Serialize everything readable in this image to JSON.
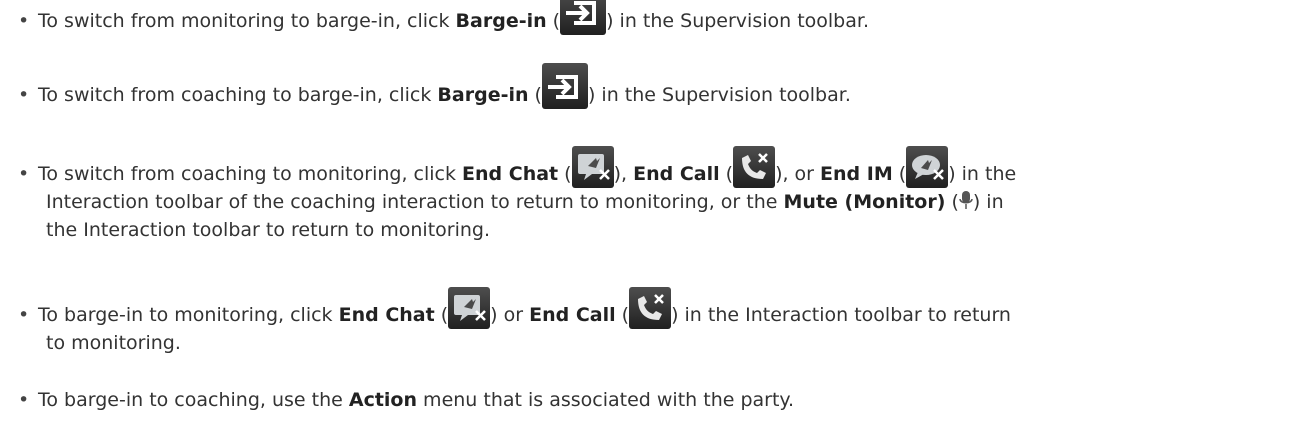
{
  "bullets": [
    {
      "before": "To switch from monitoring to barge-in, click ",
      "bold1": "Barge-in",
      "open1": " (",
      "after1": ") in the Supervision toolbar."
    },
    {
      "before": "To switch from coaching to barge-in, click ",
      "bold1": "Barge-in",
      "open1": " (",
      "after1": ") in the Supervision toolbar."
    },
    {
      "before": "To switch from coaching to monitoring, click ",
      "bold1": "End Chat",
      "open1": " (",
      "after1": "), ",
      "bold2": "End Call",
      "open2": " (",
      "after2": "), or ",
      "bold3": "End IM",
      "open3": " (",
      "after3": ") in the",
      "line2_before": "Interaction toolbar of the coaching interaction to return to monitoring, or the ",
      "line2_bold": "Mute (Monitor)",
      "line2_open": " (",
      "line2_after": ") in",
      "line3": "the Interaction toolbar to return to monitoring."
    },
    {
      "before": "To barge-in to monitoring, click ",
      "bold1": "End Chat",
      "open1": " (",
      "after1": ") or ",
      "bold2": "End Call",
      "open2": " (",
      "after2": ") in the Interaction toolbar to return",
      "line2": "to monitoring."
    },
    {
      "before": "To barge-in to coaching, use the ",
      "bold1": "Action",
      "after1": " menu that is associated with the party."
    }
  ],
  "icons": {
    "barge_in": "barge-in-icon",
    "end_chat": "end-chat-icon",
    "end_call": "end-call-icon",
    "end_im": "end-im-icon",
    "mute": "microphone-icon"
  }
}
